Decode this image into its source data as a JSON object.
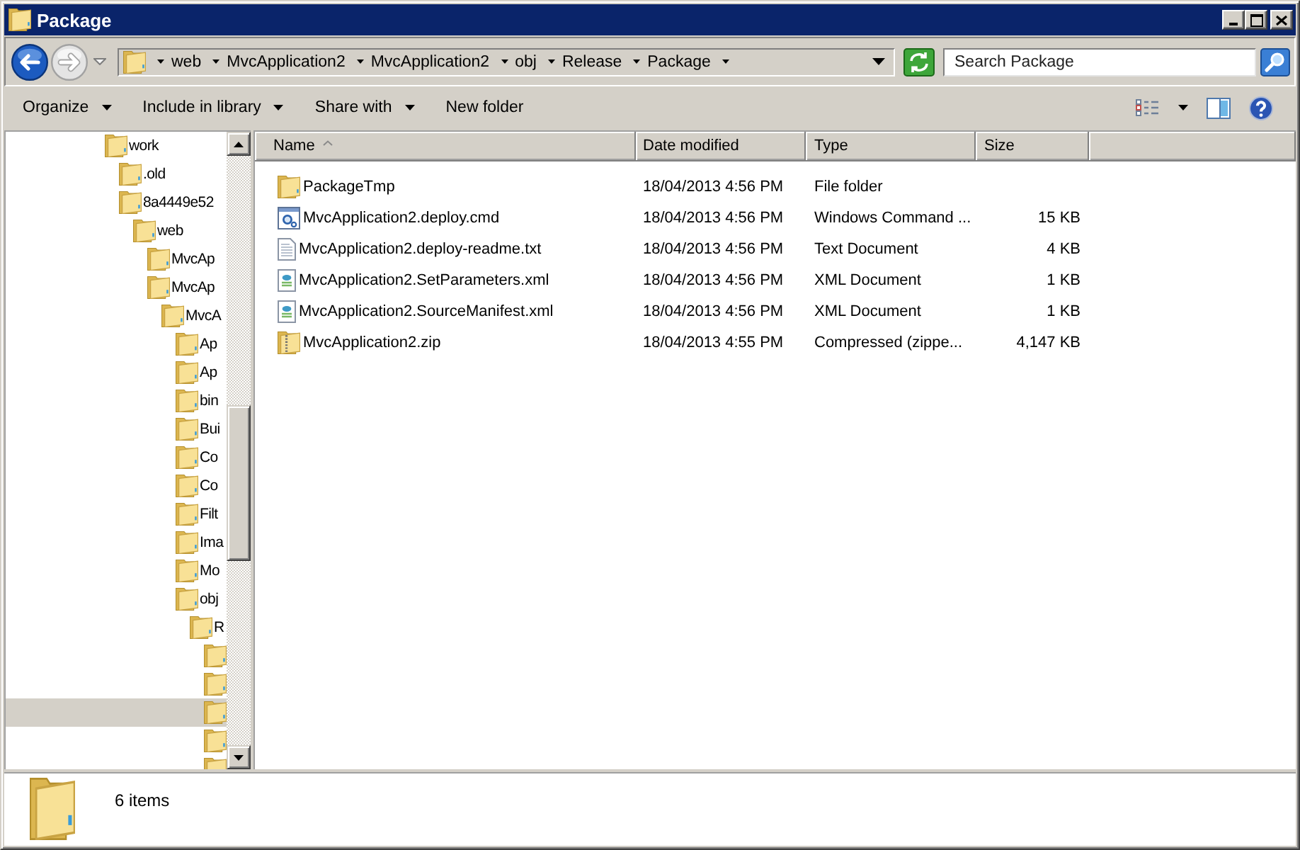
{
  "window": {
    "title": "Package"
  },
  "navigation": [
    {
      "kind": "back",
      "disabled": false
    },
    {
      "kind": "forward",
      "disabled": true
    }
  ],
  "address_bar": {
    "path": [
      "web",
      "MvcApplication2",
      "MvcApplication2",
      "obj",
      "Release",
      "Package"
    ]
  },
  "search": {
    "placeholder": "Search Package"
  },
  "toolbar": {
    "commands": [
      {
        "label": "Organize",
        "dropdown": true
      },
      {
        "label": "Include in library",
        "dropdown": true
      },
      {
        "label": "Share with",
        "dropdown": true
      },
      {
        "label": "New folder",
        "dropdown": false
      }
    ]
  },
  "navigation_pane": {
    "tree": [
      {
        "label": "work",
        "selected": false,
        "children": [
          {
            "label": ".old",
            "selected": false
          },
          {
            "label": "8a4449e52",
            "selected": false,
            "children": [
              {
                "label": "web",
                "selected": false,
                "children": [
                  {
                    "label": "MvcAp",
                    "selected": false
                  },
                  {
                    "label": "MvcAp",
                    "selected": false,
                    "children": [
                      {
                        "label": "MvcA",
                        "selected": false,
                        "children": [
                          {
                            "label": "Ap",
                            "selected": false
                          },
                          {
                            "label": "Ap",
                            "selected": false
                          },
                          {
                            "label": "bin",
                            "selected": false
                          },
                          {
                            "label": "Bui",
                            "selected": false
                          },
                          {
                            "label": "Co",
                            "selected": false
                          },
                          {
                            "label": "Co",
                            "selected": false
                          },
                          {
                            "label": "Filt",
                            "selected": false
                          },
                          {
                            "label": "Ima",
                            "selected": false
                          },
                          {
                            "label": "Mo",
                            "selected": false
                          },
                          {
                            "label": "obj",
                            "selected": false,
                            "children": [
                              {
                                "label": "R",
                                "selected": false,
                                "children": [
                                  {
                                    "selected": false
                                  },
                                  {
                                    "selected": false
                                  },
                                  {
                                    "selected": true
                                  },
                                  {
                                    "selected": false
                                  },
                                  {
                                    "selected": false
                                  }
                                ]
                              }
                            ]
                          }
                        ]
                      }
                    ]
                  }
                ]
              }
            ]
          }
        ]
      }
    ]
  },
  "file_list": {
    "columns": [
      {
        "label": "Name",
        "sorted": true
      },
      {
        "label": "Date modified",
        "sorted": false
      },
      {
        "label": "Type",
        "sorted": false
      },
      {
        "label": "Size",
        "sorted": false
      }
    ],
    "rows": [
      {
        "kind": "folder",
        "name": "PackageTmp",
        "date_modified": "18/04/2013 4:56 PM",
        "type": "File folder"
      },
      {
        "kind": "cmd",
        "name": "MvcApplication2.deploy.cmd",
        "date_modified": "18/04/2013 4:56 PM",
        "type": "Windows Command ...",
        "size": "15 KB"
      },
      {
        "kind": "txt",
        "name": "MvcApplication2.deploy-readme.txt",
        "date_modified": "18/04/2013 4:56 PM",
        "type": "Text Document",
        "size": "4 KB"
      },
      {
        "kind": "xml",
        "name": "MvcApplication2.SetParameters.xml",
        "date_modified": "18/04/2013 4:56 PM",
        "type": "XML Document",
        "size": "1 KB"
      },
      {
        "kind": "xml",
        "name": "MvcApplication2.SourceManifest.xml",
        "date_modified": "18/04/2013 4:56 PM",
        "type": "XML Document",
        "size": "1 KB"
      },
      {
        "kind": "zip",
        "name": "MvcApplication2.zip",
        "date_modified": "18/04/2013 4:55 PM",
        "type": "Compressed (zippe...",
        "size": "4,147 KB"
      }
    ]
  },
  "details_pane": {
    "item_count": "6 items"
  }
}
